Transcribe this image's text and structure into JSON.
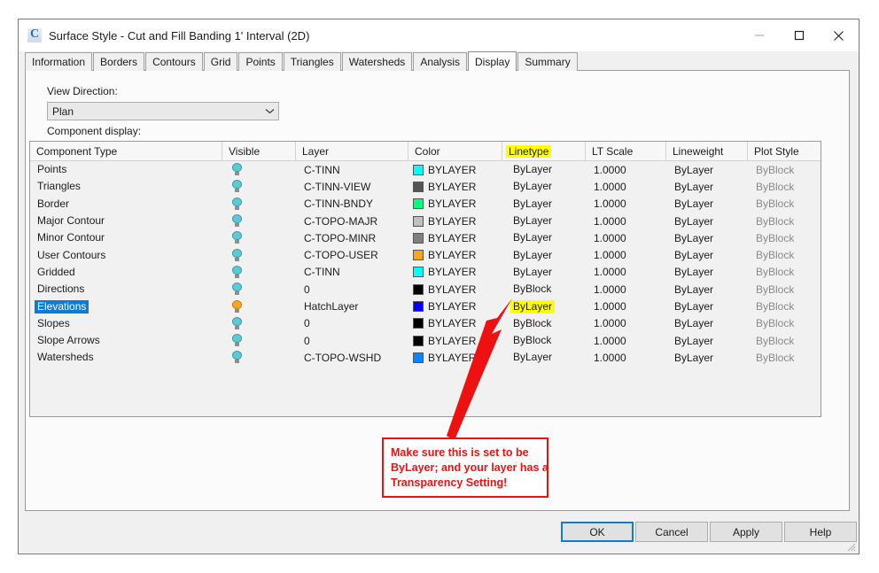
{
  "window": {
    "title": "Surface Style - Cut and Fill Banding 1' Interval (2D)",
    "app_icon": "C",
    "minimize": "minimize-icon",
    "maximize": "maximize-icon",
    "close": "close-icon"
  },
  "tabs": [
    {
      "label": "Information",
      "active": false
    },
    {
      "label": "Borders",
      "active": false
    },
    {
      "label": "Contours",
      "active": false
    },
    {
      "label": "Grid",
      "active": false
    },
    {
      "label": "Points",
      "active": false
    },
    {
      "label": "Triangles",
      "active": false
    },
    {
      "label": "Watersheds",
      "active": false
    },
    {
      "label": "Analysis",
      "active": false
    },
    {
      "label": "Display",
      "active": true
    },
    {
      "label": "Summary",
      "active": false
    }
  ],
  "display_tab": {
    "view_direction_label": "View Direction:",
    "view_direction_value": "Plan",
    "component_display_label": "Component display:",
    "columns": [
      {
        "key": "component_type",
        "label": "Component Type",
        "highlight": false
      },
      {
        "key": "visible",
        "label": "Visible",
        "highlight": false
      },
      {
        "key": "layer",
        "label": "Layer",
        "highlight": false
      },
      {
        "key": "color",
        "label": "Color",
        "highlight": false
      },
      {
        "key": "linetype",
        "label": "Linetype",
        "highlight": true
      },
      {
        "key": "lt_scale",
        "label": "LT Scale",
        "highlight": false
      },
      {
        "key": "lineweight",
        "label": "Lineweight",
        "highlight": false
      },
      {
        "key": "plot_style",
        "label": "Plot Style",
        "highlight": false
      }
    ],
    "rows": [
      {
        "component_type": "Points",
        "visible": "off",
        "layer": "C-TINN",
        "color_swatch": "#00ffff",
        "color": "BYLAYER",
        "linetype": "ByLayer",
        "linetype_highlight": false,
        "lt_scale": "1.0000",
        "lineweight": "ByLayer",
        "plot_style": "ByBlock",
        "selected": false
      },
      {
        "component_type": "Triangles",
        "visible": "off",
        "layer": "C-TINN-VIEW",
        "color_swatch": "#555555",
        "color": "BYLAYER",
        "linetype": "ByLayer",
        "linetype_highlight": false,
        "lt_scale": "1.0000",
        "lineweight": "ByLayer",
        "plot_style": "ByBlock",
        "selected": false
      },
      {
        "component_type": "Border",
        "visible": "off",
        "layer": "C-TINN-BNDY",
        "color_swatch": "#00ff7f",
        "color": "BYLAYER",
        "linetype": "ByLayer",
        "linetype_highlight": false,
        "lt_scale": "1.0000",
        "lineweight": "ByLayer",
        "plot_style": "ByBlock",
        "selected": false
      },
      {
        "component_type": "Major Contour",
        "visible": "off",
        "layer": "C-TOPO-MAJR",
        "color_swatch": "#c0c0c0",
        "color": "BYLAYER",
        "linetype": "ByLayer",
        "linetype_highlight": false,
        "lt_scale": "1.0000",
        "lineweight": "ByLayer",
        "plot_style": "ByBlock",
        "selected": false
      },
      {
        "component_type": "Minor Contour",
        "visible": "off",
        "layer": "C-TOPO-MINR",
        "color_swatch": "#808080",
        "color": "BYLAYER",
        "linetype": "ByLayer",
        "linetype_highlight": false,
        "lt_scale": "1.0000",
        "lineweight": "ByLayer",
        "plot_style": "ByBlock",
        "selected": false
      },
      {
        "component_type": "User Contours",
        "visible": "off",
        "layer": "C-TOPO-USER",
        "color_swatch": "#f5a623",
        "color": "BYLAYER",
        "linetype": "ByLayer",
        "linetype_highlight": false,
        "lt_scale": "1.0000",
        "lineweight": "ByLayer",
        "plot_style": "ByBlock",
        "selected": false
      },
      {
        "component_type": "Gridded",
        "visible": "off",
        "layer": "C-TINN",
        "color_swatch": "#00ffff",
        "color": "BYLAYER",
        "linetype": "ByLayer",
        "linetype_highlight": false,
        "lt_scale": "1.0000",
        "lineweight": "ByLayer",
        "plot_style": "ByBlock",
        "selected": false
      },
      {
        "component_type": "Directions",
        "visible": "off",
        "layer": "0",
        "color_swatch": "#000000",
        "color": "BYLAYER",
        "linetype": "ByBlock",
        "linetype_highlight": false,
        "lt_scale": "1.0000",
        "lineweight": "ByLayer",
        "plot_style": "ByBlock",
        "selected": false
      },
      {
        "component_type": "Elevations",
        "visible": "on",
        "layer": "HatchLayer",
        "color_swatch": "#0000ff",
        "color": "BYLAYER",
        "linetype": "ByLayer",
        "linetype_highlight": true,
        "lt_scale": "1.0000",
        "lineweight": "ByLayer",
        "plot_style": "ByBlock",
        "selected": true
      },
      {
        "component_type": "Slopes",
        "visible": "off",
        "layer": "0",
        "color_swatch": "#000000",
        "color": "BYLAYER",
        "linetype": "ByBlock",
        "linetype_highlight": false,
        "lt_scale": "1.0000",
        "lineweight": "ByLayer",
        "plot_style": "ByBlock",
        "selected": false
      },
      {
        "component_type": "Slope Arrows",
        "visible": "off",
        "layer": "0",
        "color_swatch": "#000000",
        "color": "BYLAYER",
        "linetype": "ByBlock",
        "linetype_highlight": false,
        "lt_scale": "1.0000",
        "lineweight": "ByLayer",
        "plot_style": "ByBlock",
        "selected": false
      },
      {
        "component_type": "Watersheds",
        "visible": "off",
        "layer": "C-TOPO-WSHD",
        "color_swatch": "#0a84ff",
        "color": "BYLAYER",
        "linetype": "ByLayer",
        "linetype_highlight": false,
        "lt_scale": "1.0000",
        "lineweight": "ByLayer",
        "plot_style": "ByBlock",
        "selected": false
      }
    ]
  },
  "annotation": {
    "line1": "Make sure this is set to be",
    "line2": "ByLayer; and your layer has a",
    "line3": "Transparency Setting!",
    "color": "#ee1111"
  },
  "footer": {
    "ok": "OK",
    "cancel": "Cancel",
    "apply": "Apply",
    "help": "Help"
  },
  "colors": {
    "selection_blue": "#0c7cd5",
    "highlight_yellow": "#ffff00",
    "annotation_red": "#ee1111",
    "bulb_on": "#f5a623",
    "bulb_off": "#5fc8d2"
  }
}
